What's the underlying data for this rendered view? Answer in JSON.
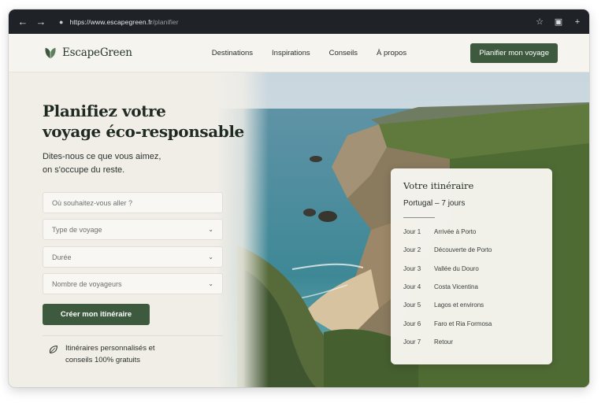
{
  "browser": {
    "url_host": "https://www.escapegreen.fr",
    "url_path": "/planifier",
    "icons": [
      "back-arrow-icon",
      "forward-arrow-icon",
      "lock-icon",
      "star-icon",
      "extensions-icon",
      "new-tab-icon"
    ]
  },
  "site": {
    "brand": "EscapeGreen",
    "nav": [
      "Destinations",
      "Inspirations",
      "Conseils",
      "À propos"
    ],
    "cta_top": "Planifier mon voyage"
  },
  "hero": {
    "title_line1": "Planifiez votre",
    "title_line2": "voyage éco-responsable",
    "subtitle_line1": "Dites-nous ce que vous aimez,",
    "subtitle_line2": "on s'occupe du reste."
  },
  "form": {
    "destination_placeholder": "Où souhaitez-vous aller ?",
    "type_placeholder": "Type de voyage",
    "duration_placeholder": "Durée",
    "travelers_placeholder": "Nombre de voyageurs",
    "submit": "Créer mon itinéraire"
  },
  "note": {
    "line1": "Itinéraires personnalisés et",
    "line2": "conseils 100% gratuits"
  },
  "itinerary": {
    "title": "Votre itinéraire",
    "country": "Portugal",
    "duration": "– 7 jours",
    "days": [
      {
        "day": "Jour 1",
        "label": "Arrivée à Porto"
      },
      {
        "day": "Jour 2",
        "label": "Découverte de Porto"
      },
      {
        "day": "Jour 3",
        "label": "Vallée du Douro"
      },
      {
        "day": "Jour 4",
        "label": "Costa Vicentina"
      },
      {
        "day": "Jour 5",
        "label": "Lagos et environs"
      },
      {
        "day": "Jour 6",
        "label": "Faro et Ria Formosa"
      },
      {
        "day": "Jour 7",
        "label": "Retour"
      }
    ]
  },
  "colors": {
    "accent": "#3e5a3e",
    "page_bg": "#f3f1ec",
    "chrome": "#1f2327"
  }
}
